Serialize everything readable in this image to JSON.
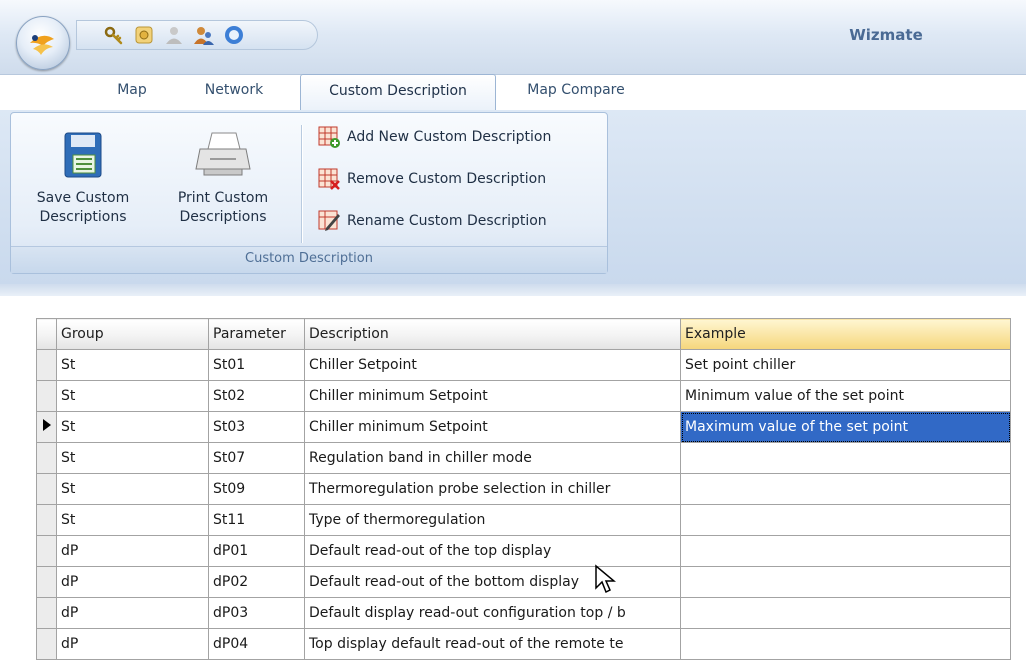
{
  "app": {
    "title": "Wizmate"
  },
  "quick_access": [
    "key-icon",
    "settings-icon",
    "user-icon",
    "users-icon",
    "circle-button-icon"
  ],
  "tabs": [
    {
      "label": "Map"
    },
    {
      "label": "Network"
    },
    {
      "label": "Custom Description",
      "active": true
    },
    {
      "label": "Map Compare"
    }
  ],
  "ribbon": {
    "group_label": "Custom Description",
    "save_line1": "Save Custom",
    "save_line2": "Descriptions",
    "print_line1": "Print Custom",
    "print_line2": "Descriptions",
    "add_label": "Add New Custom Description",
    "remove_label": "Remove Custom Description",
    "rename_label": "Rename Custom Description"
  },
  "grid": {
    "headers": {
      "group": "Group",
      "parameter": "Parameter",
      "description": "Description",
      "example": "Example"
    },
    "rows": [
      {
        "group": "St",
        "parameter": "St01",
        "description": "Chiller Setpoint",
        "example": "Set point chiller"
      },
      {
        "group": "St",
        "parameter": "St02",
        "description": "Chiller minimum Setpoint",
        "example": "Minimum value of the set point"
      },
      {
        "group": "St",
        "parameter": "St03",
        "description": "Chiller minimum Setpoint",
        "example": "Maximum value of the set point"
      },
      {
        "group": "St",
        "parameter": "St07",
        "description": "Regulation band in chiller mode",
        "example": ""
      },
      {
        "group": "St",
        "parameter": "St09",
        "description": "Thermoregulation probe selection  in chiller",
        "example": ""
      },
      {
        "group": "St",
        "parameter": "St11",
        "description": "Type of thermoregulation",
        "example": ""
      },
      {
        "group": "dP",
        "parameter": "dP01",
        "description": "Default read-out of the top display",
        "example": ""
      },
      {
        "group": "dP",
        "parameter": "dP02",
        "description": "Default read-out of the bottom display",
        "example": ""
      },
      {
        "group": "dP",
        "parameter": "dP03",
        "description": "Default display read-out configuration  top / b",
        "example": ""
      },
      {
        "group": "dP",
        "parameter": "dP04",
        "description": "Top display default read-out of the remote te",
        "example": ""
      }
    ]
  },
  "colors": {
    "selection": "#3169c6",
    "example_header": "#f5d67c",
    "ribbon": "#dde8f5"
  }
}
